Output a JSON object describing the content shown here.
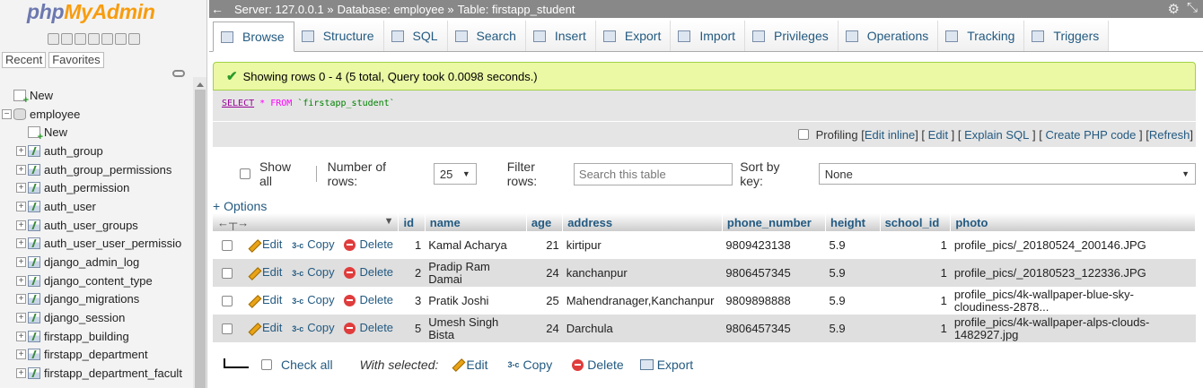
{
  "nav": {
    "logo_a": "php",
    "logo_b": "MyAdmin",
    "recent": "Recent",
    "favorites": "Favorites",
    "tree": [
      {
        "label": "New",
        "indent": 0,
        "kind": "new"
      },
      {
        "label": "employee",
        "indent": 0,
        "kind": "db"
      },
      {
        "label": "New",
        "indent": 1,
        "kind": "new"
      },
      {
        "label": "auth_group",
        "indent": 1,
        "kind": "tbl"
      },
      {
        "label": "auth_group_permissions",
        "indent": 1,
        "kind": "tbl"
      },
      {
        "label": "auth_permission",
        "indent": 1,
        "kind": "tbl"
      },
      {
        "label": "auth_user",
        "indent": 1,
        "kind": "tbl"
      },
      {
        "label": "auth_user_groups",
        "indent": 1,
        "kind": "tbl"
      },
      {
        "label": "auth_user_user_permissio",
        "indent": 1,
        "kind": "tbl"
      },
      {
        "label": "django_admin_log",
        "indent": 1,
        "kind": "tbl"
      },
      {
        "label": "django_content_type",
        "indent": 1,
        "kind": "tbl"
      },
      {
        "label": "django_migrations",
        "indent": 1,
        "kind": "tbl"
      },
      {
        "label": "django_session",
        "indent": 1,
        "kind": "tbl"
      },
      {
        "label": "firstapp_building",
        "indent": 1,
        "kind": "tbl"
      },
      {
        "label": "firstapp_department",
        "indent": 1,
        "kind": "tbl"
      },
      {
        "label": "firstapp_department_facult",
        "indent": 1,
        "kind": "tbl"
      }
    ]
  },
  "breadcrumb": {
    "server": "Server: 127.0.0.1 »",
    "database": "Database: employee »",
    "table": "Table: firstapp_student"
  },
  "tabs": [
    "Browse",
    "Structure",
    "SQL",
    "Search",
    "Insert",
    "Export",
    "Import",
    "Privileges",
    "Operations",
    "Tracking",
    "Triggers"
  ],
  "message": "Showing rows 0 - 4 (5 total, Query took 0.0098 seconds.)",
  "sql": {
    "kw": "SELECT",
    "op": "*",
    "from": "FROM",
    "tbl": "`firstapp_student`"
  },
  "sql_links": {
    "profiling": "Profiling",
    "edit_inline": "Edit inline",
    "edit": "Edit",
    "explain": "Explain SQL",
    "php": "Create PHP code",
    "refresh": "Refresh"
  },
  "controls": {
    "show_all": "Show all",
    "num_rows_label": "Number of rows:",
    "num_rows_value": "25",
    "filter_label": "Filter rows:",
    "filter_placeholder": "Search this table",
    "sort_label": "Sort by key:",
    "sort_value": "None"
  },
  "options": "+ Options",
  "columns": [
    "id",
    "name",
    "age",
    "address",
    "phone_number",
    "height",
    "school_id",
    "photo"
  ],
  "actions": {
    "edit": "Edit",
    "copy": "Copy",
    "delete": "Delete"
  },
  "rows": [
    {
      "id": "1",
      "name": "Kamal Acharya",
      "age": "21",
      "address": "kirtipur",
      "phone": "9809423138",
      "height": "5.9",
      "school_id": "1",
      "photo": "profile_pics/_20180524_200146.JPG"
    },
    {
      "id": "2",
      "name": "Pradip Ram Damai",
      "age": "24",
      "address": "kanchanpur",
      "phone": "9806457345",
      "height": "5.9",
      "school_id": "1",
      "photo": "profile_pics/_20180523_122336.JPG"
    },
    {
      "id": "3",
      "name": "Pratik Joshi",
      "age": "25",
      "address": "Mahendranager,Kanchanpur",
      "phone": "9809898888",
      "height": "5.9",
      "school_id": "1",
      "photo": "profile_pics/4k-wallpaper-blue-sky-cloudiness-2878..."
    },
    {
      "id": "5",
      "name": "Umesh Singh Bista",
      "age": "24",
      "address": "Darchula",
      "phone": "9806457345",
      "height": "5.9",
      "school_id": "1",
      "photo": "profile_pics/4k-wallpaper-alps-clouds-1482927.jpg"
    }
  ],
  "bottom": {
    "check_all": "Check all",
    "with_selected": "With selected:",
    "edit": "Edit",
    "copy": "Copy",
    "delete": "Delete",
    "export": "Export"
  }
}
